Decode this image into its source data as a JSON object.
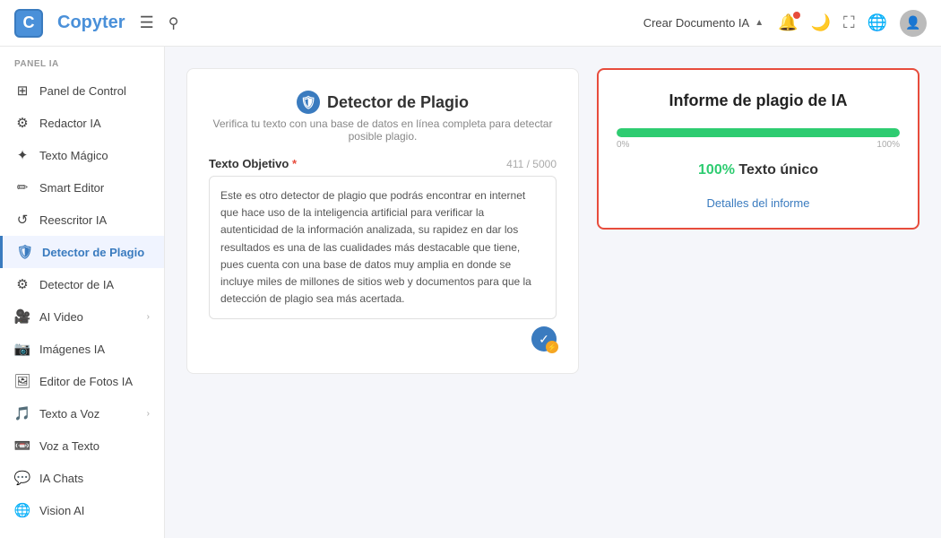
{
  "header": {
    "logo_letter": "C",
    "logo_name": "Copyter",
    "menu_icon": "☰",
    "search_icon": "🔍",
    "crear_doc_label": "Crear Documento IA",
    "crear_doc_arrow": "▲"
  },
  "sidebar": {
    "section_label": "PANEL IA",
    "items": [
      {
        "id": "panel-control",
        "icon": "⊞",
        "label": "Panel de Control",
        "active": false
      },
      {
        "id": "redactor-ia",
        "icon": "⚙",
        "label": "Redactor IA",
        "active": false
      },
      {
        "id": "texto-magico",
        "icon": "✦",
        "label": "Texto Mágico",
        "active": false
      },
      {
        "id": "smart-editor",
        "icon": "✏",
        "label": "Smart Editor",
        "active": false
      },
      {
        "id": "reescritor-ia",
        "icon": "↺",
        "label": "Reescritor IA",
        "active": false
      },
      {
        "id": "detector-plagio",
        "icon": "🛡",
        "label": "Detector de Plagio",
        "active": true
      },
      {
        "id": "detector-ia",
        "icon": "⚙",
        "label": "Detector de IA",
        "active": false
      },
      {
        "id": "ai-video",
        "icon": "🎥",
        "label": "AI Video",
        "active": false,
        "chevron": true
      },
      {
        "id": "imagenes-ia",
        "icon": "📷",
        "label": "Imágenes IA",
        "active": false
      },
      {
        "id": "editor-fotos-ia",
        "icon": "🖼",
        "label": "Editor de Fotos IA",
        "active": false
      },
      {
        "id": "texto-a-voz",
        "icon": "🎵",
        "label": "Texto a Voz",
        "active": false,
        "chevron": true
      },
      {
        "id": "voz-a-texto",
        "icon": "📼",
        "label": "Voz a Texto",
        "active": false
      },
      {
        "id": "ia-chats",
        "icon": "💬",
        "label": "IA Chats",
        "active": false
      },
      {
        "id": "vision-ai",
        "icon": "🌐",
        "label": "Vision AI",
        "active": false
      }
    ]
  },
  "main": {
    "left_panel": {
      "icon": "🛡",
      "title": "Detector de Plagio",
      "subtitle": "Verifica tu texto con una base de datos en línea completa para detectar posible plagio.",
      "text_field_label": "Texto Objetivo",
      "required": true,
      "char_count": "411 / 5000",
      "text_content": "Este es otro detector de plagio que podrás encontrar en internet que hace uso de la inteligencia artificial para verificar la autenticidad de la información analizada, su rapidez en dar los resultados es una de las cualidades más destacable que tiene, pues cuenta con una base de datos muy amplia en donde se incluye miles de millones de sitios web y documentos para que la detección de plagio sea más acertada."
    },
    "right_panel": {
      "title": "Informe de plagio de IA",
      "progress_0": "0%",
      "progress_100": "100%",
      "progress_value": 100,
      "unique_percent": "100%",
      "unique_label": "Texto único",
      "details_link": "Detalles del informe"
    }
  }
}
